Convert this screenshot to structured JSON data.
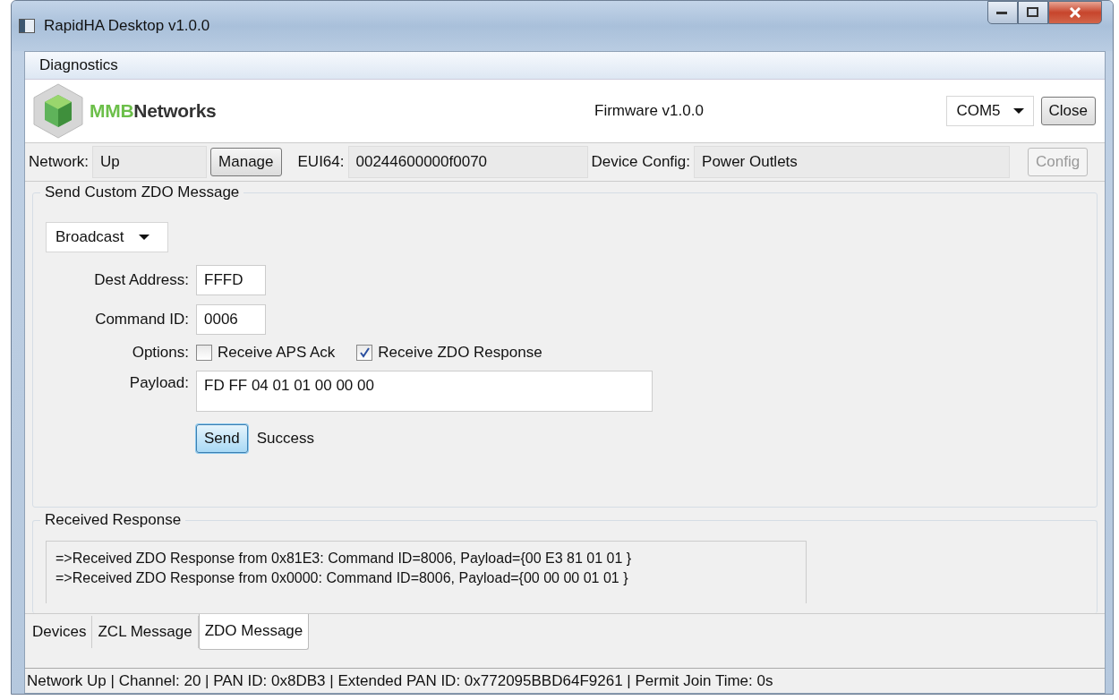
{
  "window": {
    "title": "RapidHA Desktop v1.0.0"
  },
  "menu": [
    {
      "label": "Diagnostics"
    }
  ],
  "header": {
    "logo_mark": "MMB",
    "logo_text": "Networks",
    "firmware": "Firmware v1.0.0",
    "port": "COM5",
    "close_button": "Close"
  },
  "network_bar": {
    "network_label": "Network:",
    "network_value": "Up",
    "manage_button": "Manage",
    "eui_label": "EUI64:",
    "eui_value": "00244600000f0070",
    "config_label": "Device Config:",
    "config_value": "Power Outlets",
    "config_button": {
      "label": "Config",
      "disabled": true
    }
  },
  "send_group": {
    "title": "Send Custom ZDO Message",
    "mode": "Broadcast",
    "dest_label": "Dest Address:",
    "dest_value": "FFFD",
    "command_label": "Command ID:",
    "command_value": "0006",
    "options_label": "Options:",
    "options": [
      {
        "label": "Receive APS Ack",
        "checked": false
      },
      {
        "label": "Receive ZDO Response",
        "checked": true
      }
    ],
    "payload_label": "Payload:",
    "payload_value": "FD FF 04 01 01 00 00 00",
    "send_button": "Send",
    "result": "Success"
  },
  "response_group": {
    "title": "Received Response",
    "lines": [
      "=>Received ZDO Response from 0x81E3: Command ID=8006, Payload={00 E3 81 01 01 }",
      "=>Received ZDO Response from 0x0000: Command ID=8006, Payload={00 00 00 01 01 }"
    ]
  },
  "tabs": [
    {
      "label": "Devices",
      "selected": false
    },
    {
      "label": "ZCL Message",
      "selected": false
    },
    {
      "label": "ZDO Message",
      "selected": true
    }
  ],
  "status_bar": "Network Up | Channel: 20 | PAN ID: 0x8DB3 | Extended PAN ID: 0x772095BBD64F9261 | Permit Join Time: 0s"
}
